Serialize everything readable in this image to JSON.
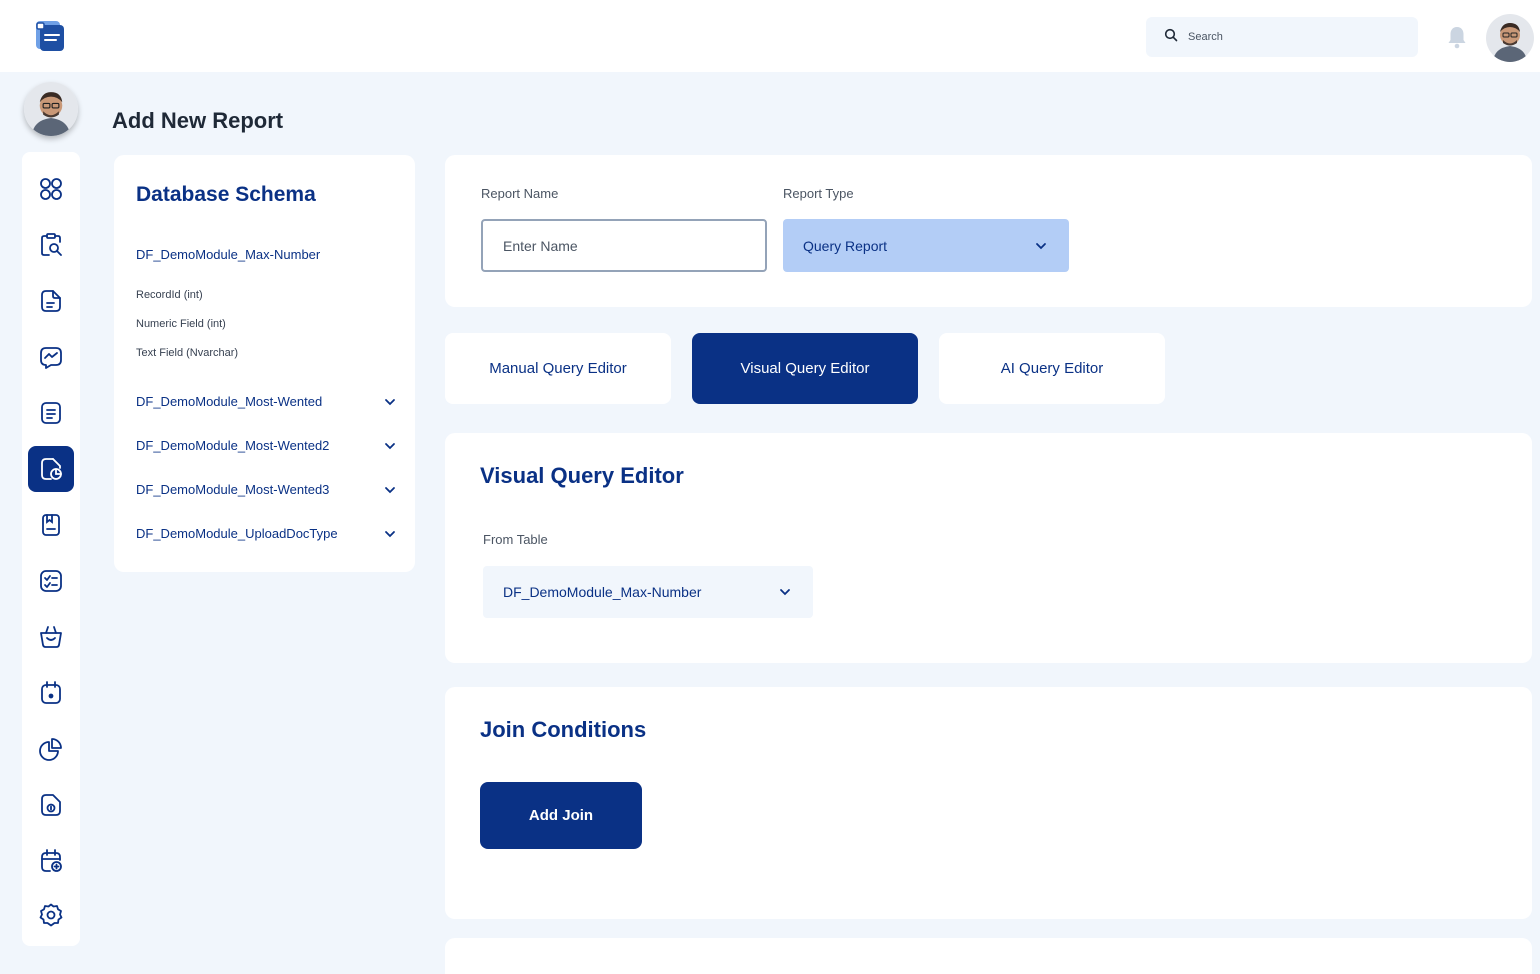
{
  "header": {
    "search_placeholder": "Search"
  },
  "page": {
    "title": "Add New Report"
  },
  "sidebar": {
    "active_index": 5,
    "items": [
      "grid-icon",
      "clipboard-search-icon",
      "document-icon",
      "chart-message-icon",
      "report-icon",
      "pie-report-icon",
      "save-doc-icon",
      "checklist-icon",
      "basket-icon",
      "calendar-icon",
      "pie-chart-icon",
      "file-upload-icon",
      "calendar-add-icon",
      "settings-icon"
    ]
  },
  "schema": {
    "title": "Database Schema",
    "expanded_table": "DF_DemoModule_Max-Number",
    "fields": [
      "RecordId (int)",
      "Numeric Field (int)",
      "Text Field (Nvarchar)"
    ],
    "collapsed_tables": [
      "DF_DemoModule_Most-Wented",
      "DF_DemoModule_Most-Wented2",
      "DF_DemoModule_Most-Wented3",
      "DF_DemoModule_UploadDocType"
    ]
  },
  "report_form": {
    "name_label": "Report Name",
    "name_placeholder": "Enter Name",
    "type_label": "Report Type",
    "type_value": "Query Report"
  },
  "tabs": {
    "manual": "Manual Query Editor",
    "visual": "Visual Query Editor",
    "ai": "AI Query Editor",
    "active": "visual"
  },
  "visual_editor": {
    "title": "Visual Query Editor",
    "from_label": "From Table",
    "from_value": "DF_DemoModule_Max-Number"
  },
  "join_conditions": {
    "title": "Join Conditions",
    "add_button": "Add Join"
  },
  "colors": {
    "primary": "#0a3185",
    "select_bg": "#b3cdf6",
    "page_bg": "#f1f6fc"
  }
}
